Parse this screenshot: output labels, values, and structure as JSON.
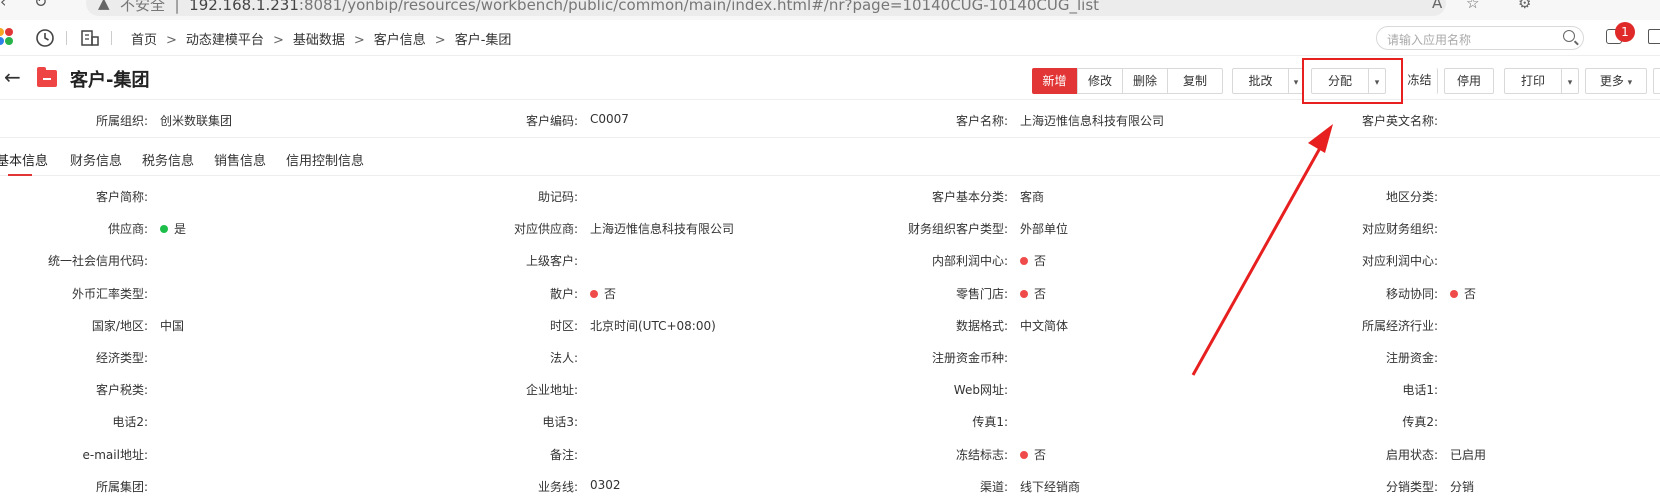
{
  "browser": {
    "security_label": "不安全",
    "url_host": "192.168.1.231",
    "url_rest": ":8081/yonbip/resources/workbench/public/common/main/index.html#/nr?page=10140CUG-10140CUG_list"
  },
  "app": {
    "breadcrumb": [
      "首页",
      "动态建模平台",
      "基础数据",
      "客户信息",
      "客户-集团"
    ],
    "search_placeholder": "请输入应用名称",
    "notification_count": "1"
  },
  "page": {
    "title": "客户-集团",
    "buttons": {
      "add": "新增",
      "edit": "修改",
      "delete": "删除",
      "copy": "复制",
      "batch_edit": "批改",
      "assign": "分配",
      "freeze": "冻结",
      "disable": "停用",
      "print": "打印",
      "more": "更多"
    }
  },
  "header_fields": [
    {
      "label": "所属组织:",
      "value": "创米数联集团"
    },
    {
      "label": "客户编码:",
      "value": "C0007"
    },
    {
      "label": "客户名称:",
      "value": "上海迈惟信息科技有限公司"
    },
    {
      "label": "客户英文名称:",
      "value": ""
    }
  ],
  "tabs": [
    "基本信息",
    "财务信息",
    "税务信息",
    "销售信息",
    "信用控制信息"
  ],
  "form_rows": [
    [
      {
        "label": "客户简称:",
        "value": ""
      },
      {
        "label": "助记码:",
        "value": ""
      },
      {
        "label": "客户基本分类:",
        "value": "客商"
      },
      {
        "label": "地区分类:",
        "value": ""
      }
    ],
    [
      {
        "label": "供应商:",
        "value": "是",
        "dot": "#1dbf4a"
      },
      {
        "label": "对应供应商:",
        "value": "上海迈惟信息科技有限公司"
      },
      {
        "label": "财务组织客户类型:",
        "value": "外部单位"
      },
      {
        "label": "对应财务组织:",
        "value": ""
      }
    ],
    [
      {
        "label": "统一社会信用代码:",
        "value": ""
      },
      {
        "label": "上级客户:",
        "value": ""
      },
      {
        "label": "内部利润中心:",
        "value": "否",
        "dot": "#f04b4b"
      },
      {
        "label": "对应利润中心:",
        "value": ""
      }
    ],
    [
      {
        "label": "外币汇率类型:",
        "value": ""
      },
      {
        "label": "散户:",
        "value": "否",
        "dot": "#f04b4b"
      },
      {
        "label": "零售门店:",
        "value": "否",
        "dot": "#f04b4b"
      },
      {
        "label": "移动协同:",
        "value": "否",
        "dot": "#f04b4b"
      }
    ],
    [
      {
        "label": "国家/地区:",
        "value": "中国"
      },
      {
        "label": "时区:",
        "value": "北京时间(UTC+08:00)"
      },
      {
        "label": "数据格式:",
        "value": "中文简体"
      },
      {
        "label": "所属经济行业:",
        "value": ""
      }
    ],
    [
      {
        "label": "经济类型:",
        "value": ""
      },
      {
        "label": "法人:",
        "value": ""
      },
      {
        "label": "注册资金币种:",
        "value": ""
      },
      {
        "label": "注册资金:",
        "value": ""
      }
    ],
    [
      {
        "label": "客户税类:",
        "value": ""
      },
      {
        "label": "企业地址:",
        "value": ""
      },
      {
        "label": "Web网址:",
        "value": ""
      },
      {
        "label": "电话1:",
        "value": ""
      }
    ],
    [
      {
        "label": "电话2:",
        "value": ""
      },
      {
        "label": "电话3:",
        "value": ""
      },
      {
        "label": "传真1:",
        "value": ""
      },
      {
        "label": "传真2:",
        "value": ""
      }
    ],
    [
      {
        "label": "e-mail地址:",
        "value": ""
      },
      {
        "label": "备注:",
        "value": ""
      },
      {
        "label": "冻结标志:",
        "value": "否",
        "dot": "#f04b4b"
      },
      {
        "label": "启用状态:",
        "value": "已启用"
      }
    ],
    [
      {
        "label": "所属集团:",
        "value": ""
      },
      {
        "label": "业务线:",
        "value": "0302"
      },
      {
        "label": "渠道:",
        "value": "线下经销商"
      },
      {
        "label": "分销类型:",
        "value": "分销"
      }
    ]
  ],
  "colors": {
    "accent": "#e23636",
    "annotation": "#e81f1f"
  }
}
